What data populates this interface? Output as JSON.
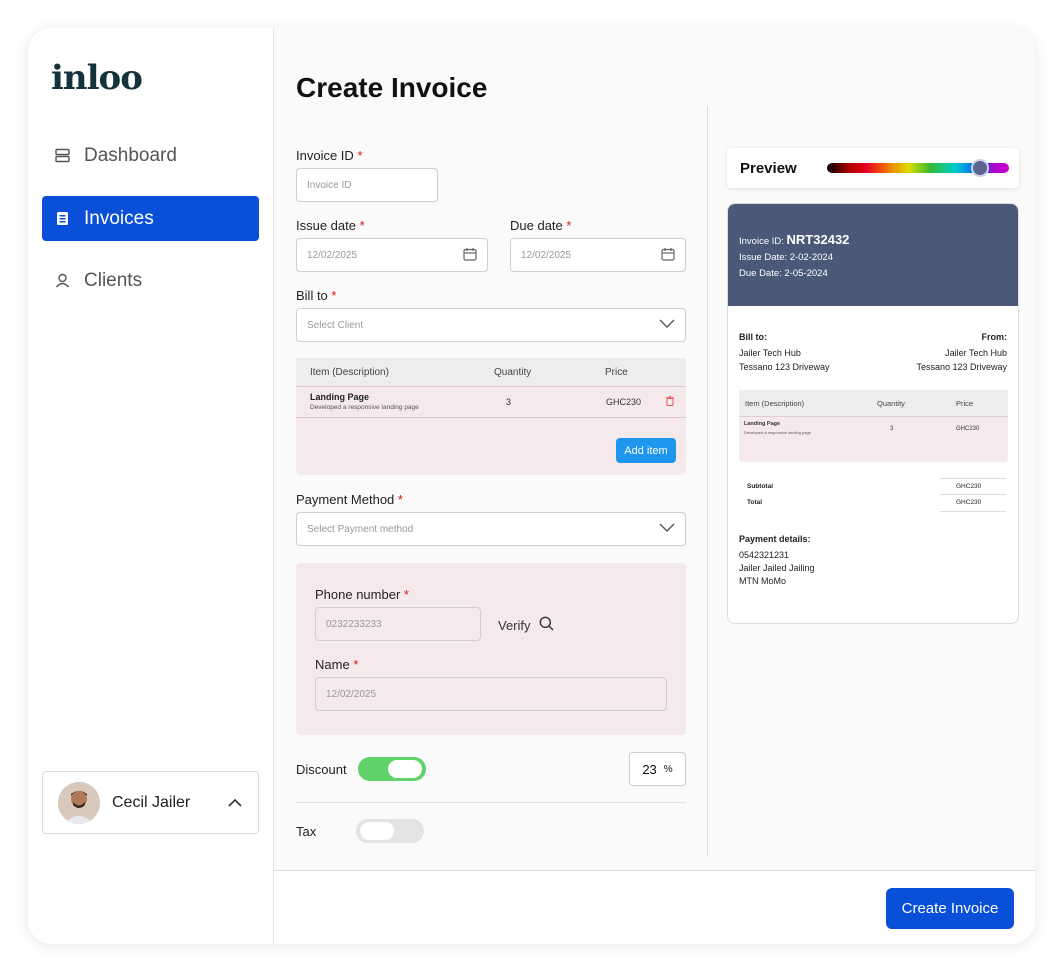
{
  "sidebar": {
    "logo": "inloo",
    "nav": [
      {
        "label": "Dashboard",
        "icon": "dashboard-icon"
      },
      {
        "label": "Invoices",
        "icon": "invoice-icon"
      },
      {
        "label": "Clients",
        "icon": "clients-icon"
      }
    ],
    "user": {
      "name": "Cecil Jailer"
    }
  },
  "form": {
    "title": "Create Invoice",
    "invoice_id": {
      "label": "Invoice ID",
      "placeholder": "Invoice ID"
    },
    "issue_date": {
      "label": "Issue date",
      "value": "12/02/2025"
    },
    "due_date": {
      "label": "Due date",
      "value": "12/02/2025"
    },
    "bill_to": {
      "label": "Bill to",
      "placeholder": "Select Client"
    },
    "required_mark": "*",
    "items": {
      "headers": [
        "Item (Description)",
        "Quantity",
        "Price"
      ],
      "rows": [
        {
          "title": "Landing Page",
          "desc": "Developed a responsive landing page",
          "qty": "3",
          "price": "GHC230"
        }
      ],
      "add_label": "Add item"
    },
    "payment_method": {
      "label": "Payment Method",
      "placeholder": "Select Payment method"
    },
    "phone": {
      "label": "Phone number",
      "placeholder": "0232233233",
      "verify_label": "Verify"
    },
    "name": {
      "label": "Name",
      "placeholder": "12/02/2025"
    },
    "discount": {
      "label": "Discount",
      "enabled": true,
      "value": "23",
      "unit": "%"
    },
    "tax": {
      "label": "Tax",
      "enabled": false
    },
    "submit_label": "Create Invoice"
  },
  "preview": {
    "title": "Preview",
    "invoice_id_label": "Invoice ID:",
    "invoice_id": "NRT32432",
    "issue_date": "Issue Date: 2-02-2024",
    "due_date": "Due Date: 2-05-2024",
    "bill_to_label": "Bill to:",
    "bill_to_name": "Jailer Tech Hub",
    "bill_to_address": "Tessano 123 Driveway",
    "from_label": "From:",
    "from_name": "Jailer Tech Hub",
    "from_address": "Tessano 123 Driveway",
    "table_headers": [
      "Item (Description)",
      "Quantity",
      "Price"
    ],
    "row": {
      "title": "Landing Page",
      "desc": "Developed a responsive landing page",
      "qty": "3",
      "price": "GHC230"
    },
    "subtotal_label": "Subtotal",
    "subtotal": "GHC230",
    "total_label": "Total",
    "total": "GHC230",
    "payment_details_label": "Payment details:",
    "payment_lines": [
      "0542321231",
      "Jailer Jailed Jailing",
      "MTN MoMo"
    ]
  },
  "colors": {
    "primary": "#0a4fd8",
    "add_button": "#1e96ee",
    "toggle_on": "#5fd36a",
    "preview_header": "#4b5878",
    "pink_panel": "#f6e9ec"
  }
}
